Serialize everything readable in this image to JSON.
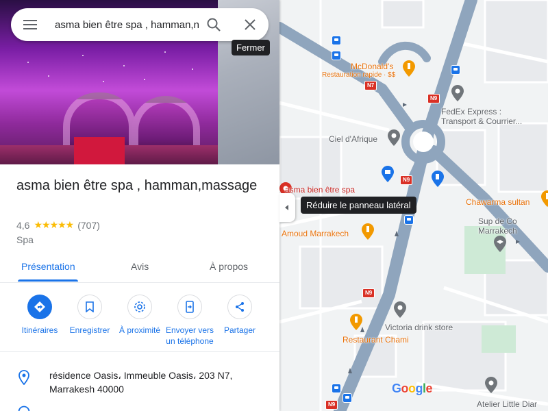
{
  "search": {
    "query": "asma bien être spa , hamman,massage",
    "display_text": "asma bien être spa , hamman,n"
  },
  "tooltips": {
    "close": "Fermer",
    "collapse": "Réduire le panneau latéral"
  },
  "place": {
    "title": "asma bien être spa , hamman,massage",
    "rating": "4,6",
    "stars": "★★★★★",
    "reviews": "(707)",
    "category": "Spa",
    "address_line1": "résidence Oasis، Immeuble Oasis، 203 N7,",
    "address_line2": "Marrakesh 40000"
  },
  "tabs": [
    {
      "label": "Présentation"
    },
    {
      "label": "Avis"
    },
    {
      "label": "À propos"
    }
  ],
  "actions": [
    {
      "label": "Itinéraires"
    },
    {
      "label": "Enregistrer"
    },
    {
      "label": "À proximité"
    },
    {
      "label": "Envoyer vers un téléphone"
    },
    {
      "label": "Partager"
    }
  ],
  "map": {
    "labels": {
      "mcdonalds": "McDonald's",
      "mcdonalds_sub": "Restauration rapide · $$",
      "fedex": "FedEx Express :",
      "fedex2": "Transport & Courrier...",
      "ciel": "Ciel d'Afrique",
      "asma": "asma bien être spa",
      "chawarma": "Chawarma sultan",
      "supdeco": "Sup de Co",
      "supdeco2": "Marrakech",
      "amoud": "Amoud Marrakech",
      "victoria": "Victoria drink store",
      "chami": "Restaurant Chami",
      "atelier": "Atelier Little Diar"
    },
    "routes": {
      "n7": "N7",
      "n9": "N9"
    },
    "google": [
      "G",
      "o",
      "o",
      "g",
      "l",
      "e"
    ]
  },
  "colors": {
    "accent": "#1a73e8",
    "star": "#fbbc04",
    "road": "#8fa5bd",
    "poi_orange": "#e8710a",
    "poi_red": "#c5221f"
  }
}
